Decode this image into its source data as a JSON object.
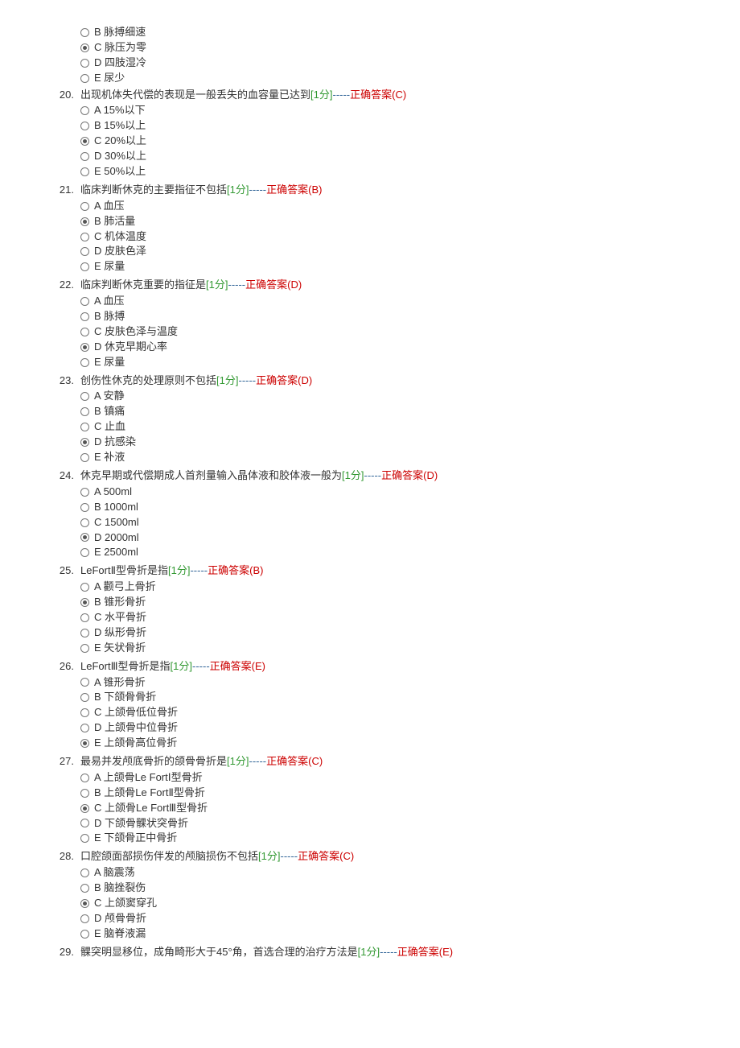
{
  "separator": "-----",
  "answerPrefix": "正确答案",
  "pointsLabel": "1分",
  "orphanOptions": [
    {
      "letter": "B",
      "text": "脉搏细速",
      "selected": false
    },
    {
      "letter": "C",
      "text": "脉压为零",
      "selected": true
    },
    {
      "letter": "D",
      "text": "四肢湿冷",
      "selected": false
    },
    {
      "letter": "E",
      "text": "尿少",
      "selected": false
    }
  ],
  "questions": [
    {
      "num": "20.",
      "stem": "出现机体失代偿的表现是一般丢失的血容量已达到",
      "answer": "C",
      "options": [
        {
          "letter": "A",
          "text": "15%以下",
          "selected": false
        },
        {
          "letter": "B",
          "text": "15%以上",
          "selected": false
        },
        {
          "letter": "C",
          "text": "20%以上",
          "selected": true
        },
        {
          "letter": "D",
          "text": "30%以上",
          "selected": false
        },
        {
          "letter": "E",
          "text": "50%以上",
          "selected": false
        }
      ]
    },
    {
      "num": "21.",
      "stem": "临床判断休克的主要指征不包括",
      "answer": "B",
      "options": [
        {
          "letter": "A",
          "text": "血压",
          "selected": false
        },
        {
          "letter": "B",
          "text": "肺活量",
          "selected": true
        },
        {
          "letter": "C",
          "text": "机体温度",
          "selected": false
        },
        {
          "letter": "D",
          "text": "皮肤色泽",
          "selected": false
        },
        {
          "letter": "E",
          "text": "尿量",
          "selected": false
        }
      ]
    },
    {
      "num": "22.",
      "stem": "临床判断休克重要的指征是",
      "answer": "D",
      "options": [
        {
          "letter": "A",
          "text": "血压",
          "selected": false
        },
        {
          "letter": "B",
          "text": "脉搏",
          "selected": false
        },
        {
          "letter": "C",
          "text": "皮肤色泽与温度",
          "selected": false
        },
        {
          "letter": "D",
          "text": "休克早期心率",
          "selected": true
        },
        {
          "letter": "E",
          "text": "尿量",
          "selected": false
        }
      ]
    },
    {
      "num": "23.",
      "stem": "创伤性休克的处理原则不包括",
      "answer": "D",
      "options": [
        {
          "letter": "A",
          "text": "安静",
          "selected": false
        },
        {
          "letter": "B",
          "text": "镇痛",
          "selected": false
        },
        {
          "letter": "C",
          "text": "止血",
          "selected": false
        },
        {
          "letter": "D",
          "text": "抗感染",
          "selected": true
        },
        {
          "letter": "E",
          "text": "补液",
          "selected": false
        }
      ]
    },
    {
      "num": "24.",
      "stem": "休克早期或代偿期成人首剂量输入晶体液和胶体液一般为",
      "answer": "D",
      "options": [
        {
          "letter": "A",
          "text": "500ml",
          "selected": false
        },
        {
          "letter": "B",
          "text": "1000ml",
          "selected": false
        },
        {
          "letter": "C",
          "text": "1500ml",
          "selected": false
        },
        {
          "letter": "D",
          "text": "2000ml",
          "selected": true
        },
        {
          "letter": "E",
          "text": "2500ml",
          "selected": false
        }
      ]
    },
    {
      "num": "25.",
      "stem": "LeFortⅡ型骨折是指",
      "answer": "B",
      "options": [
        {
          "letter": "A",
          "text": "颧弓上骨折",
          "selected": false
        },
        {
          "letter": "B",
          "text": "锥形骨折",
          "selected": true
        },
        {
          "letter": "C",
          "text": "水平骨折",
          "selected": false
        },
        {
          "letter": "D",
          "text": "纵形骨折",
          "selected": false
        },
        {
          "letter": "E",
          "text": "矢状骨折",
          "selected": false
        }
      ]
    },
    {
      "num": "26.",
      "stem": "LeFortⅢ型骨折是指",
      "answer": "E",
      "options": [
        {
          "letter": "A",
          "text": "锥形骨折",
          "selected": false
        },
        {
          "letter": "B",
          "text": "下颌骨骨折",
          "selected": false
        },
        {
          "letter": "C",
          "text": "上颌骨低位骨折",
          "selected": false
        },
        {
          "letter": "D",
          "text": "上颌骨中位骨折",
          "selected": false
        },
        {
          "letter": "E",
          "text": "上颌骨高位骨折",
          "selected": true
        }
      ]
    },
    {
      "num": "27.",
      "stem": "最易并发颅底骨折的颌骨骨折是",
      "answer": "C",
      "options": [
        {
          "letter": "A",
          "text": "上颌骨Le FortⅠ型骨折",
          "selected": false
        },
        {
          "letter": "B",
          "text": "上颌骨Le FortⅡ型骨折",
          "selected": false
        },
        {
          "letter": "C",
          "text": "上颌骨Le FortⅢ型骨折",
          "selected": true
        },
        {
          "letter": "D",
          "text": "下颌骨髁状突骨折",
          "selected": false
        },
        {
          "letter": "E",
          "text": "下颌骨正中骨折",
          "selected": false
        }
      ]
    },
    {
      "num": "28.",
      "stem": "口腔颌面部损伤伴发的颅脑损伤不包括",
      "answer": "C",
      "options": [
        {
          "letter": "A",
          "text": "脑震荡",
          "selected": false
        },
        {
          "letter": "B",
          "text": "脑挫裂伤",
          "selected": false
        },
        {
          "letter": "C",
          "text": "上颌窦穿孔",
          "selected": true
        },
        {
          "letter": "D",
          "text": "颅骨骨折",
          "selected": false
        },
        {
          "letter": "E",
          "text": "脑脊液漏",
          "selected": false
        }
      ]
    },
    {
      "num": "29.",
      "stem": "髁突明显移位，成角畸形大于45°角，首选合理的治疗方法是",
      "answer": "E",
      "options": []
    }
  ]
}
